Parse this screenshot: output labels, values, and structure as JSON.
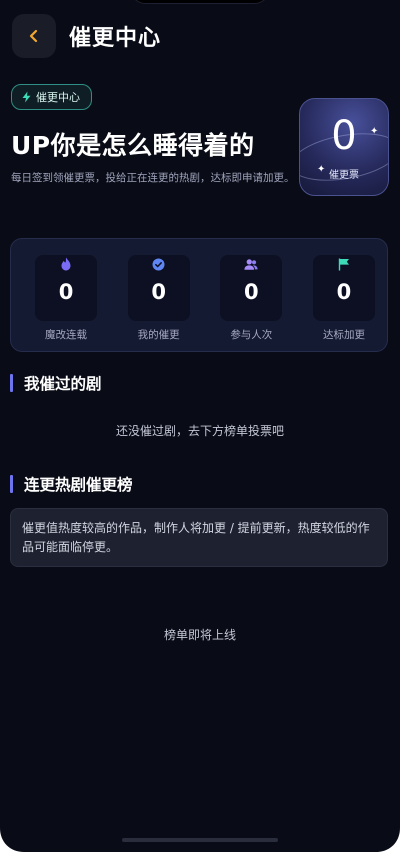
{
  "header": {
    "title": "催更中心"
  },
  "hero": {
    "badge": "催更中心",
    "headline": "UP你是怎么睡得着的",
    "subtitle": "每日签到领催更票，投给正在连更的热剧，达标即申请加更。",
    "ticket": {
      "count": "0",
      "label": "催更票"
    }
  },
  "stats": [
    {
      "icon": "fire-icon",
      "value": "0",
      "label": "魔改连载",
      "color": "#7b6cf6"
    },
    {
      "icon": "badge-check-icon",
      "value": "0",
      "label": "我的催更",
      "color": "#5f86f2"
    },
    {
      "icon": "users-icon",
      "value": "0",
      "label": "参与人次",
      "color": "#a78bfa"
    },
    {
      "icon": "flag-icon",
      "value": "0",
      "label": "达标加更",
      "color": "#3ddbb8"
    }
  ],
  "my_dramas": {
    "title": "我催过的剧",
    "empty": "还没催过剧，去下方榜单投票吧"
  },
  "ranking": {
    "title": "连更热剧催更榜",
    "notice": "催更值热度较高的作品，制作人将加更 / 提前更新，热度较低的作品可能面临停更。",
    "status": "榜单即将上线"
  },
  "colors": {
    "background": "#090b16",
    "accent": "#6e74ee",
    "back_arrow": "#f0a830"
  }
}
